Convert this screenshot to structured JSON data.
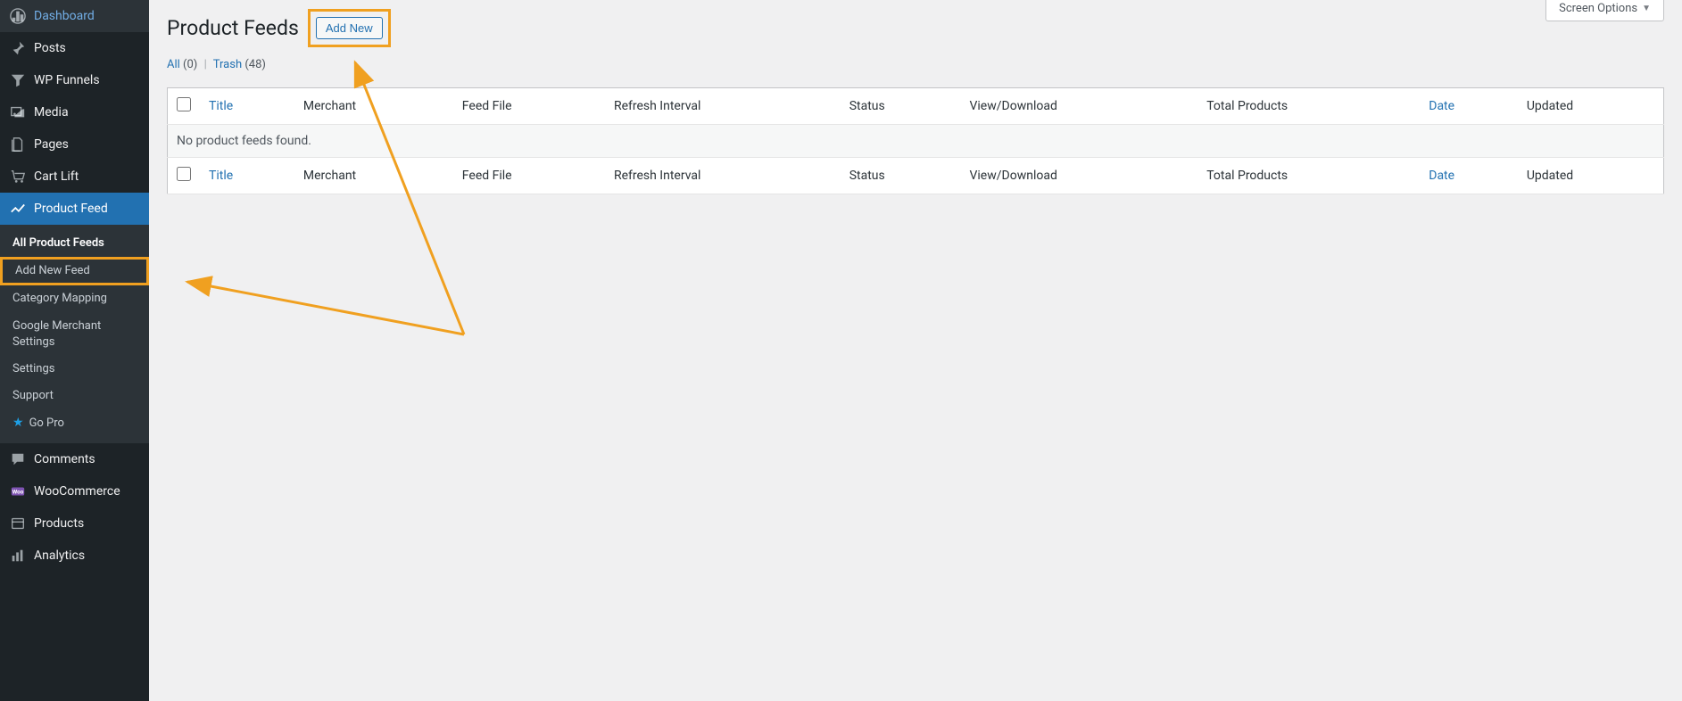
{
  "sidebar": {
    "items": [
      {
        "label": "Dashboard"
      },
      {
        "label": "Posts"
      },
      {
        "label": "WP Funnels"
      },
      {
        "label": "Media"
      },
      {
        "label": "Pages"
      },
      {
        "label": "Cart Lift"
      },
      {
        "label": "Product Feed"
      },
      {
        "label": "Comments"
      },
      {
        "label": "WooCommerce"
      },
      {
        "label": "Products"
      },
      {
        "label": "Analytics"
      }
    ],
    "submenu": [
      {
        "label": "All Product Feeds"
      },
      {
        "label": "Add New Feed"
      },
      {
        "label": "Category Mapping"
      },
      {
        "label": "Google Merchant Settings"
      },
      {
        "label": "Settings"
      },
      {
        "label": "Support"
      },
      {
        "label": "Go Pro"
      }
    ]
  },
  "page": {
    "title": "Product Feeds",
    "add_new_label": "Add New",
    "screen_options_label": "Screen Options"
  },
  "filters": {
    "all_label": "All",
    "all_count": "(0)",
    "trash_label": "Trash",
    "trash_count": "(48)"
  },
  "table": {
    "columns": {
      "title": "Title",
      "merchant": "Merchant",
      "feed_file": "Feed File",
      "refresh_interval": "Refresh Interval",
      "status": "Status",
      "view_download": "View/Download",
      "total_products": "Total Products",
      "date": "Date",
      "updated": "Updated"
    },
    "empty_message": "No product feeds found."
  }
}
